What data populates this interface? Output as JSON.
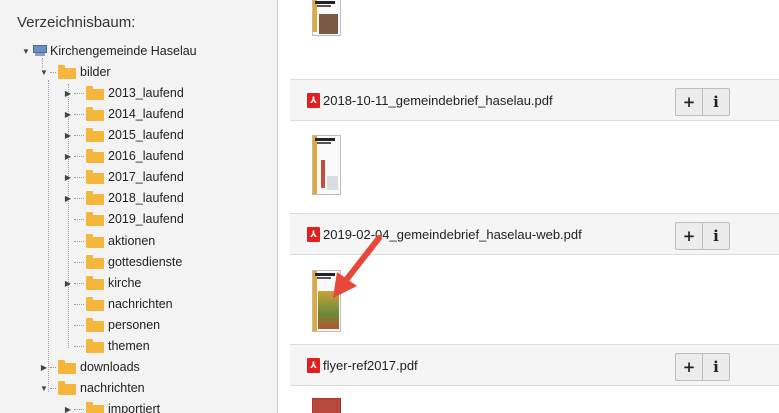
{
  "tree": {
    "title": "Verzeichnisbaum:",
    "root": "Kirchengemeinde Haselau",
    "items": [
      {
        "label": "bilder"
      },
      {
        "label": "2013_laufend"
      },
      {
        "label": "2014_laufend"
      },
      {
        "label": "2015_laufend"
      },
      {
        "label": "2016_laufend"
      },
      {
        "label": "2017_laufend"
      },
      {
        "label": "2018_laufend"
      },
      {
        "label": "2019_laufend"
      },
      {
        "label": "aktionen"
      },
      {
        "label": "gottesdienste"
      },
      {
        "label": "kirche"
      },
      {
        "label": "nachrichten"
      },
      {
        "label": "personen"
      },
      {
        "label": "themen"
      },
      {
        "label": "downloads"
      },
      {
        "label": "nachrichten"
      },
      {
        "label": "importiert"
      }
    ]
  },
  "files": [
    {
      "name": "2018-10-11_gemeindebrief_haselau.pdf"
    },
    {
      "name": "2019-02-04_gemeindebrief_haselau-web.pdf"
    },
    {
      "name": "flyer-ref2017.pdf"
    }
  ],
  "buttons": {
    "add": "+",
    "info": "i"
  },
  "colors": {
    "folder": "#f4b73c",
    "pdf": "#e02020",
    "arrow": "#e8473a"
  }
}
